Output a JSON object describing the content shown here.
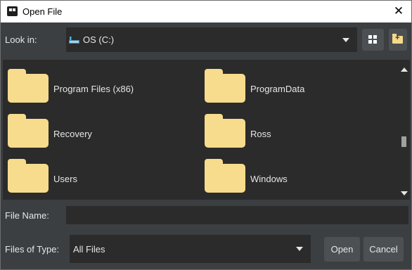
{
  "window": {
    "title": "Open File"
  },
  "look_in": {
    "label": "Look in:",
    "value": "OS (C:)"
  },
  "files": [
    {
      "name": "Program Files (x86)",
      "icon": "folder-icon"
    },
    {
      "name": "ProgramData",
      "icon": "folder-icon"
    },
    {
      "name": "Recovery",
      "icon": "folder-icon"
    },
    {
      "name": "Ross",
      "icon": "folder-icon"
    },
    {
      "name": "Users",
      "icon": "folder-icon"
    },
    {
      "name": "Windows",
      "icon": "folder-icon"
    }
  ],
  "file_name": {
    "label": "File Name:",
    "value": ""
  },
  "file_type": {
    "label": "Files of Type:",
    "value": "All Files"
  },
  "buttons": {
    "open": "Open",
    "cancel": "Cancel",
    "close": "✕"
  },
  "colors": {
    "background": "#3c3f41",
    "field": "#2b2b2b",
    "folder": "#f6dc8c",
    "button": "#4c5052"
  }
}
